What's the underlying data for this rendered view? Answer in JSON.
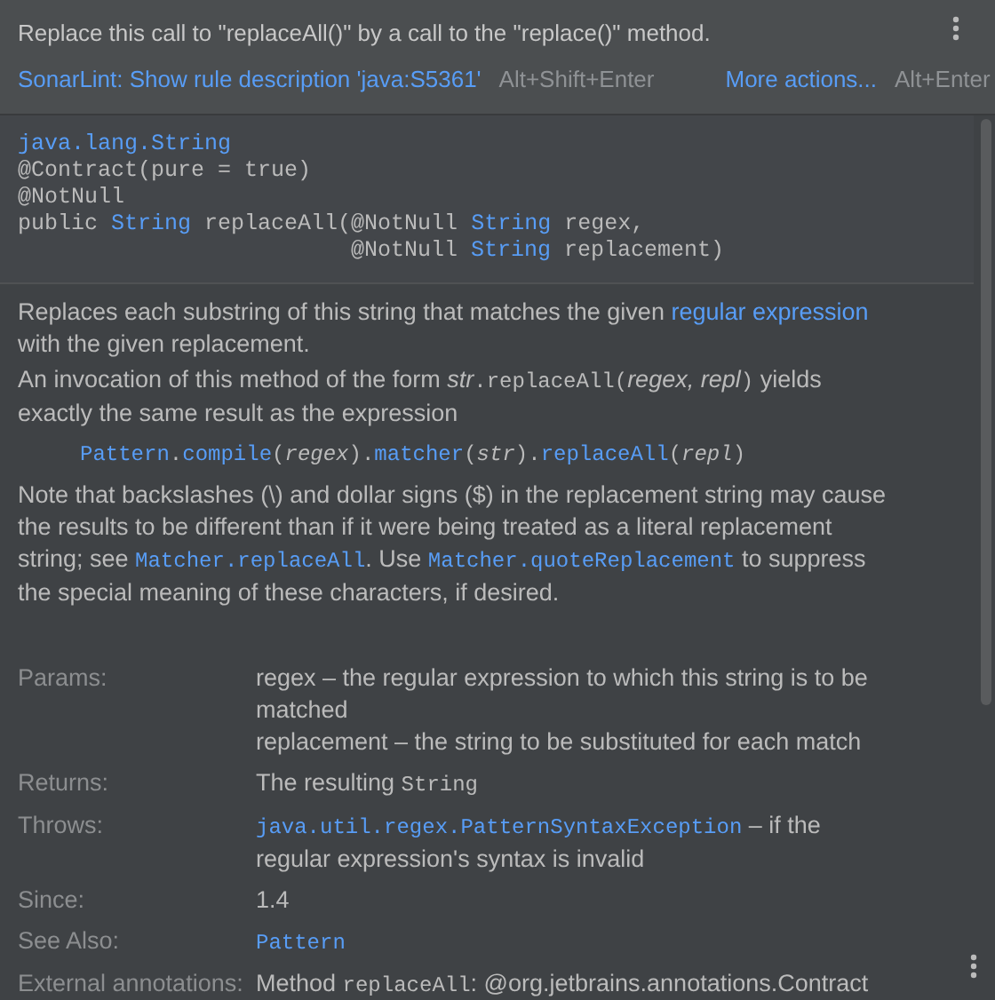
{
  "hint": {
    "message": "Replace this call to \"replaceAll()\" by a call to the \"replace()\" method.",
    "actions": [
      {
        "label": "SonarLint: Show rule description 'java:S5361'",
        "shortcut": "Alt+Shift+Enter"
      },
      {
        "label": "More actions...",
        "shortcut": "Alt+Enter"
      }
    ]
  },
  "signature": [
    {
      "indent": false,
      "tokens": [
        {
          "kind": "type",
          "text": "java.lang.String"
        }
      ]
    },
    {
      "indent": false,
      "tokens": [
        {
          "kind": "plain",
          "text": "@Contract(pure = true)"
        }
      ]
    },
    {
      "indent": false,
      "tokens": [
        {
          "kind": "plain",
          "text": "@NotNull"
        }
      ]
    },
    {
      "indent": false,
      "tokens": [
        {
          "kind": "plain",
          "text": "public "
        },
        {
          "kind": "type",
          "text": "String"
        },
        {
          "kind": "plain",
          "text": " replaceAll(@NotNull "
        },
        {
          "kind": "type",
          "text": "String"
        },
        {
          "kind": "plain",
          "text": " regex,"
        }
      ]
    },
    {
      "indent": true,
      "tokens": [
        {
          "kind": "plain",
          "text": "@NotNull "
        },
        {
          "kind": "type",
          "text": "String"
        },
        {
          "kind": "plain",
          "text": " replacement)"
        }
      ]
    }
  ],
  "description": [
    {
      "kind": "text",
      "segments": [
        {
          "kind": "text",
          "text": "Replaces each substring of this string that matches the given "
        },
        {
          "kind": "link",
          "text": "regular expression"
        },
        {
          "kind": "text",
          "text": " with the given replacement."
        }
      ]
    },
    {
      "kind": "text",
      "segments": [
        {
          "kind": "text",
          "text": "An invocation of this method of the form "
        },
        {
          "kind": "italic",
          "text": "str"
        },
        {
          "kind": "code",
          "text": ".replaceAll("
        },
        {
          "kind": "italic",
          "text": "regex, repl"
        },
        {
          "kind": "code",
          "text": ")"
        },
        {
          "kind": "text",
          "text": " yields exactly the same result as the expression"
        }
      ]
    },
    {
      "kind": "code",
      "segments": [
        {
          "kind": "code_link",
          "text": "Pattern"
        },
        {
          "kind": "code",
          "text": "."
        },
        {
          "kind": "code_link",
          "text": "compile"
        },
        {
          "kind": "code",
          "text": "("
        },
        {
          "kind": "code_italic",
          "text": "regex"
        },
        {
          "kind": "code",
          "text": ")."
        },
        {
          "kind": "code_link",
          "text": "matcher"
        },
        {
          "kind": "code",
          "text": "("
        },
        {
          "kind": "code_italic",
          "text": "str"
        },
        {
          "kind": "code",
          "text": ")."
        },
        {
          "kind": "code_link",
          "text": "replaceAll"
        },
        {
          "kind": "code",
          "text": "("
        },
        {
          "kind": "code_italic",
          "text": "repl"
        },
        {
          "kind": "code",
          "text": ")"
        }
      ]
    },
    {
      "kind": "text",
      "segments": [
        {
          "kind": "text",
          "text": "Note that backslashes (\\) and dollar signs ($) in the replacement string may cause the results to be different than if it were being treated as a literal replacement string; see "
        },
        {
          "kind": "code_link",
          "text": "Matcher.replaceAll"
        },
        {
          "kind": "text",
          "text": ". Use "
        },
        {
          "kind": "code_link",
          "text": "Matcher.quoteReplacement"
        },
        {
          "kind": "text",
          "text": " to suppress the special meaning of these characters, if desired."
        }
      ]
    }
  ],
  "sections": [
    {
      "label": "Params:",
      "values": [
        [
          {
            "kind": "text",
            "text": "regex – the regular expression to which this string is to be matched"
          }
        ],
        [
          {
            "kind": "text",
            "text": "replacement – the string to be substituted for each match"
          }
        ]
      ]
    },
    {
      "label": "Returns:",
      "values": [
        [
          {
            "kind": "text",
            "text": "The resulting "
          },
          {
            "kind": "code",
            "text": "String"
          }
        ]
      ]
    },
    {
      "label": "Throws:",
      "values": [
        [
          {
            "kind": "code_link",
            "text": "java.util.regex.PatternSyntaxException"
          },
          {
            "kind": "text",
            "text": " – if the regular expression's syntax is invalid"
          }
        ]
      ]
    },
    {
      "label": "Since:",
      "values": [
        [
          {
            "kind": "text",
            "text": "1.4"
          }
        ]
      ]
    },
    {
      "label": "See Also:",
      "values": [
        [
          {
            "kind": "code_link",
            "text": "Pattern"
          }
        ]
      ]
    },
    {
      "label": "External annotations:",
      "values": [
        [
          {
            "kind": "text",
            "text": "Method "
          },
          {
            "kind": "code",
            "text": "replaceAll"
          },
          {
            "kind": "text",
            "text": ": @org.jetbrains.annotations.Contract"
          }
        ]
      ]
    }
  ]
}
